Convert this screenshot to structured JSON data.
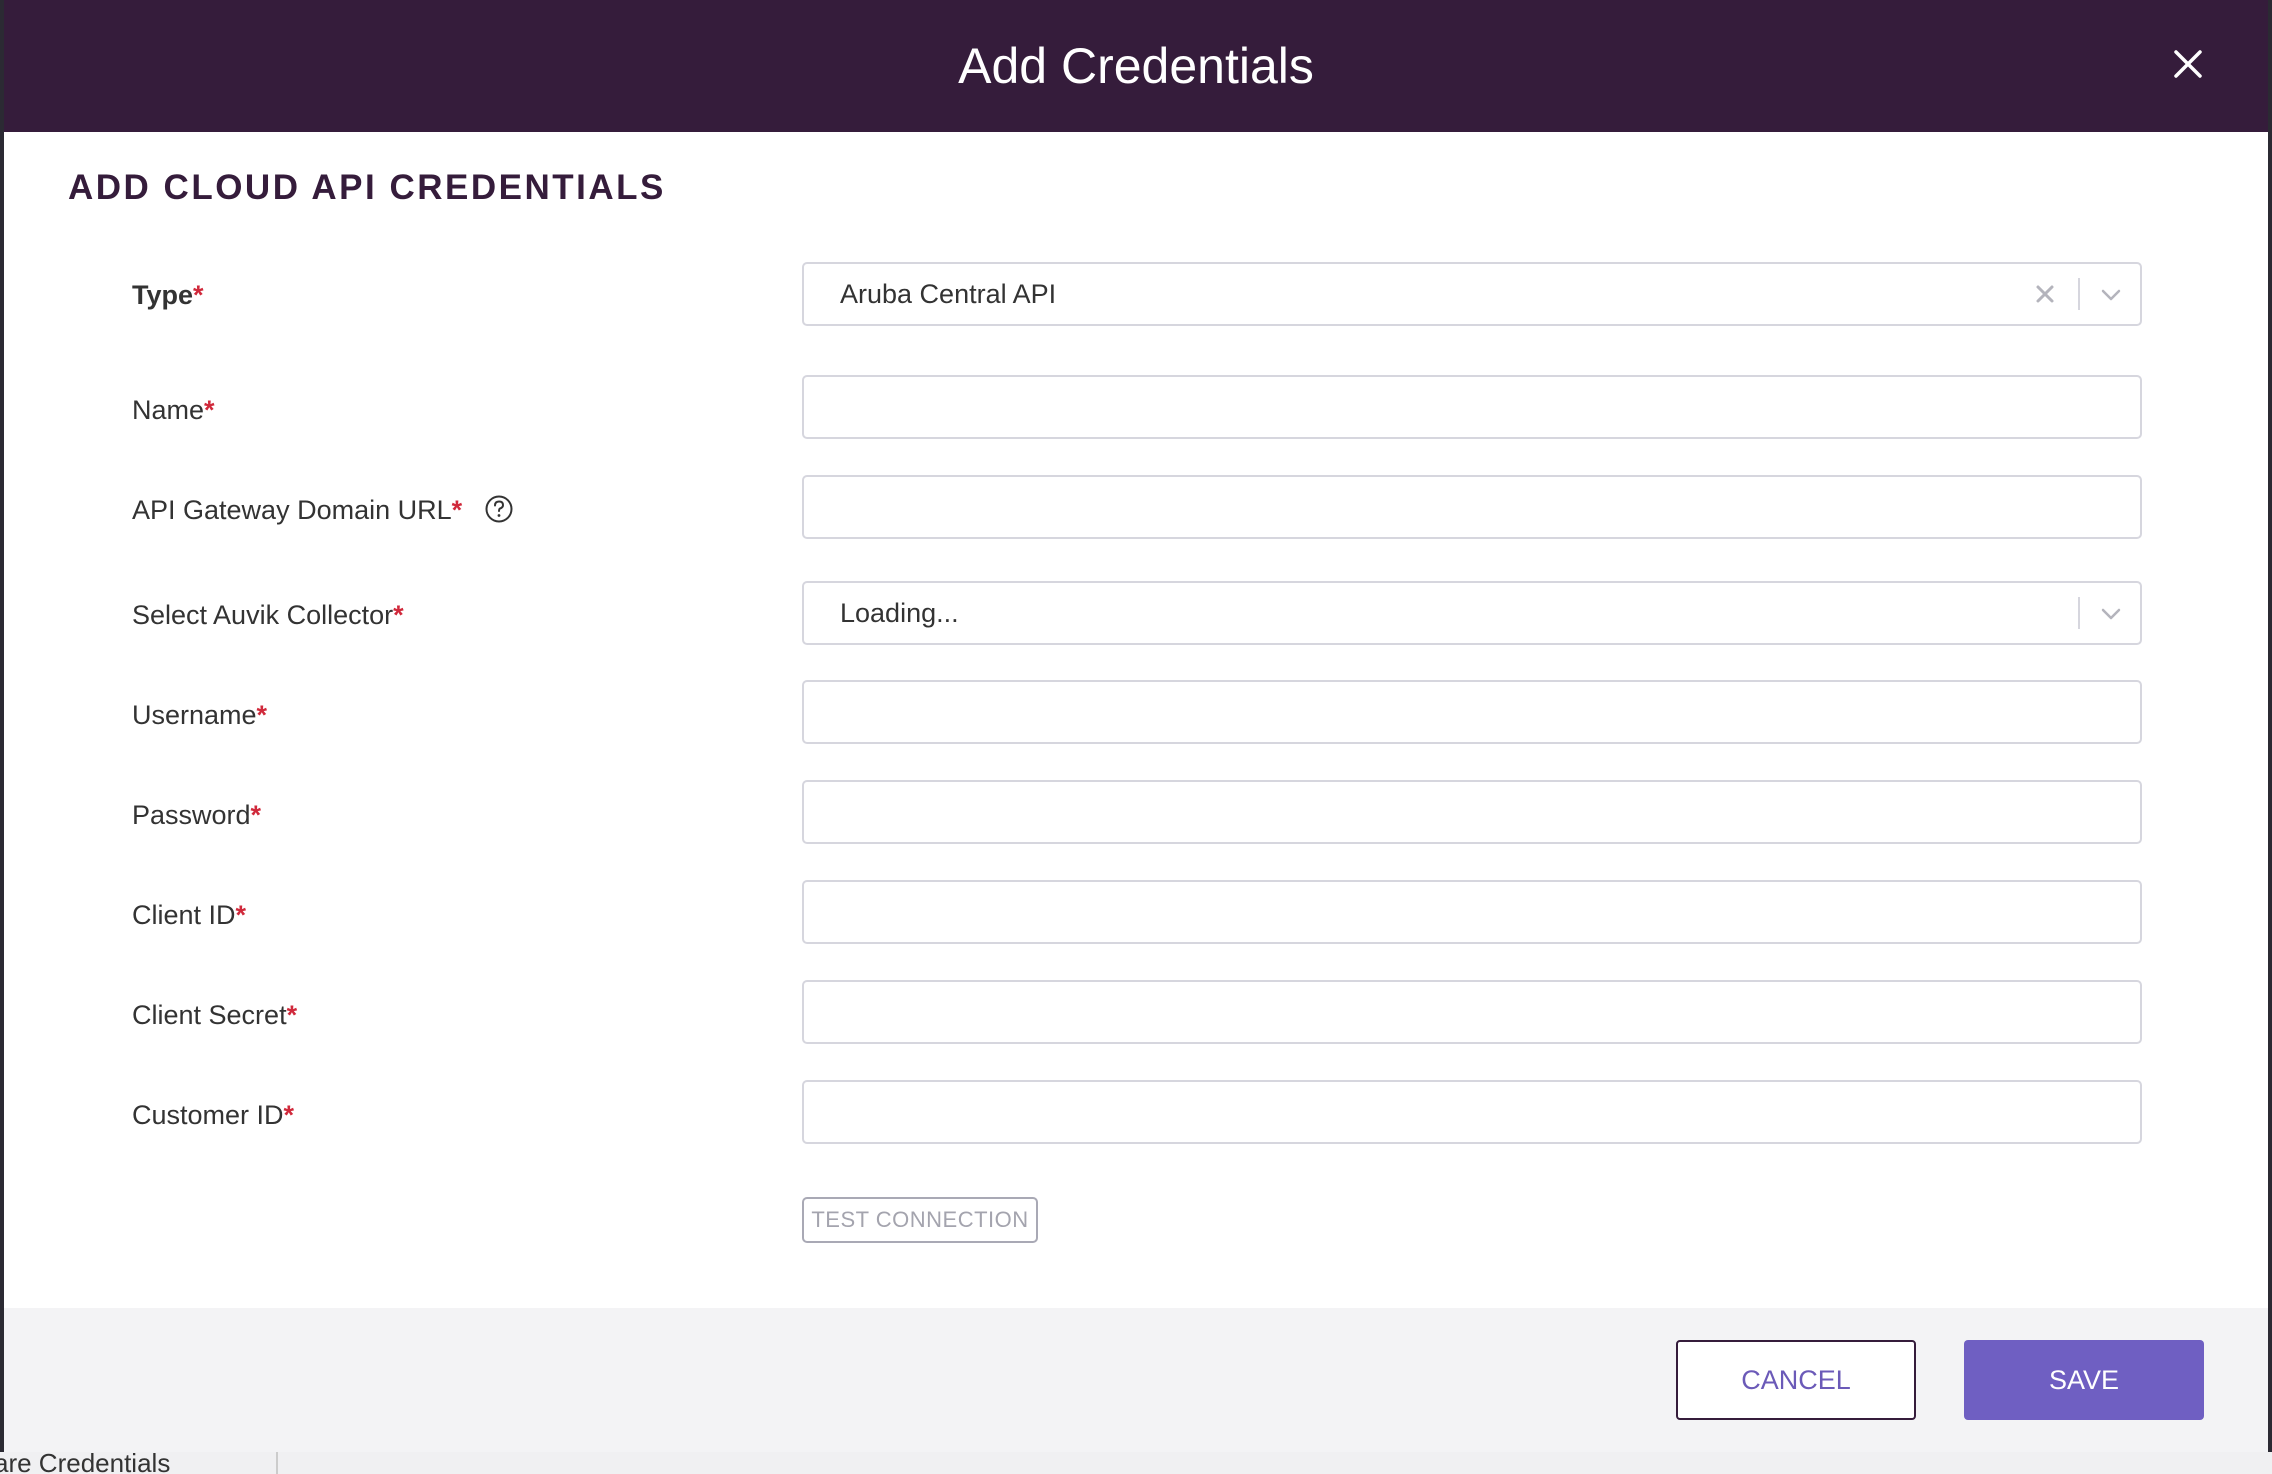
{
  "modal": {
    "title": "Add Credentials",
    "section_title": "ADD CLOUD API CREDENTIALS"
  },
  "form": {
    "type": {
      "label": "Type",
      "required_mark": "*",
      "value": "Aruba Central API"
    },
    "name": {
      "label": "Name",
      "required_mark": "*",
      "value": ""
    },
    "api_gateway": {
      "label": "API Gateway Domain URL",
      "required_mark": "*",
      "value": "",
      "help_icon": "question-circle-icon"
    },
    "collector": {
      "label": "Select Auvik Collector",
      "required_mark": "*",
      "value": "Loading..."
    },
    "username": {
      "label": "Username",
      "required_mark": "*",
      "value": ""
    },
    "password": {
      "label": "Password",
      "required_mark": "*",
      "value": ""
    },
    "client_id": {
      "label": "Client ID",
      "required_mark": "*",
      "value": ""
    },
    "client_secret": {
      "label": "Client Secret",
      "required_mark": "*",
      "value": ""
    },
    "customer_id": {
      "label": "Customer ID",
      "required_mark": "*",
      "value": ""
    },
    "test_connection_label": "TEST CONNECTION"
  },
  "footer": {
    "cancel_label": "CANCEL",
    "save_label": "SAVE"
  },
  "background": {
    "partial_text": "are Credentials"
  },
  "colors": {
    "header": "#351c3b",
    "required": "#d0293b",
    "primary": "#6f5fc2",
    "footer_bg": "#f3f3f5"
  }
}
